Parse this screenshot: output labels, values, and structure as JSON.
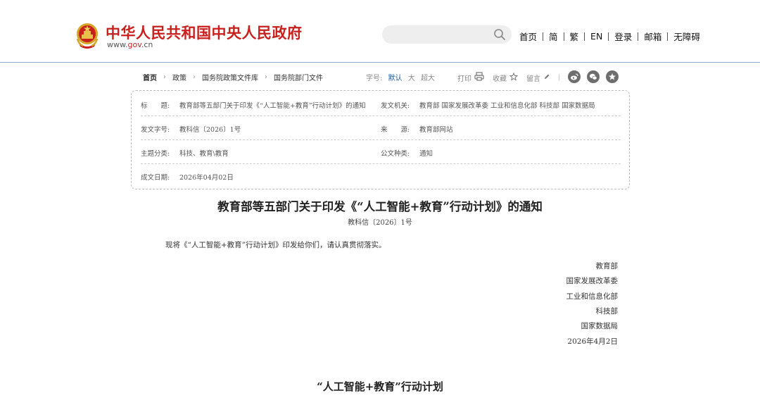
{
  "header": {
    "site_title": "中华人民共和国中央人民政府",
    "site_url_prefix": "www.",
    "site_url_red": "gov",
    "site_url_suffix": ".cn",
    "search_placeholder": "",
    "nav": [
      "首页",
      "简",
      "繁",
      "EN",
      "登录",
      "邮箱",
      "无障碍"
    ]
  },
  "breadcrumb": [
    "首页",
    "政策",
    "国务院政策文件库",
    "国务院部门文件"
  ],
  "font_size": {
    "label": "字号:",
    "options": [
      "默认",
      "大",
      "超大"
    ]
  },
  "tools": {
    "print": "打印",
    "favorite": "收藏",
    "comment": "留言"
  },
  "share": {
    "icons": [
      "weibo-icon",
      "wechat-icon",
      "star-icon"
    ]
  },
  "info": {
    "title_label": "标　　题:",
    "title_value": "教育部等五部门关于印发《“人工智能+教育”行动计划》的通知",
    "issuer_label": "发文机关:",
    "issuer_value": "教育部  国家发展改革委  工业和信息化部  科技部  国家数据局",
    "doc_no_label": "发文字号:",
    "doc_no_value": "教科信〔2026〕1号",
    "source_label": "来　　源:",
    "source_value": "教育部网站",
    "topic_label": "主题分类:",
    "topic_value": "科技、教育\\教育",
    "type_label": "公文种类:",
    "type_value": "通知",
    "date_label": "成文日期:",
    "date_value": "2026年04月02日"
  },
  "article": {
    "title": "教育部等五部门关于印发《“人工智能+教育”行动计划》的通知",
    "number": "教科信〔2026〕1号",
    "body": "现将《“人工智能+教育”行动计划》印发给你们，请认真贯彻落实。",
    "signatures": [
      "教育部",
      "国家发展改革委",
      "工业和信息化部",
      "科技部",
      "国家数据局",
      "2026年4月2日"
    ],
    "plan_title": "“人工智能+教育”行动计划"
  },
  "colors": {
    "brand_red": "#c8201d",
    "link_blue": "#1e5a9c",
    "header_line": "#8aa6c9"
  }
}
